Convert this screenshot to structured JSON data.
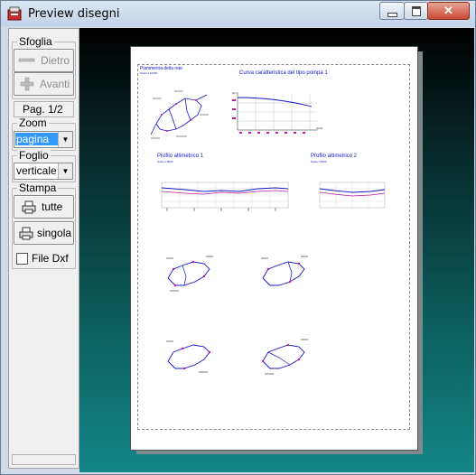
{
  "window": {
    "title": "Preview disegni",
    "controls": {
      "minimize": "minimize",
      "maximize": "maximize",
      "close": "close"
    }
  },
  "panel": {
    "sfoglia": {
      "label": "Sfoglia",
      "back": "Dietro",
      "forward": "Avanti"
    },
    "page_indicator": "Pag. 1/2",
    "zoom": {
      "label": "Zoom",
      "value": "pagina"
    },
    "foglio": {
      "label": "Foglio",
      "value": "verticale"
    },
    "stampa": {
      "label": "Stampa",
      "all": "tutte",
      "single": "singola"
    },
    "file_dxf": {
      "label": "File Dxf",
      "checked": false
    }
  },
  "drawing": {
    "planimetria_title": "Planimetria della rete",
    "planimetria_scale": "Scala 1:10000",
    "pump_curve_title": "Curva caratteristica del tipo pompa 1",
    "pump_axis_h": "H(m)",
    "pump_axis_q": "Q(l/s)",
    "profile1_title": "Profilo altimetrico 1",
    "profile1_scale": "Scala 1:5000",
    "profile2_title": "Profilo altimetrico 2",
    "profile2_scale": "Scala 1:5000"
  },
  "colors": {
    "titlebar": "#c3d3e8",
    "panel_bg": "#f0f0f0",
    "viewport_top": "#000000",
    "viewport_bottom": "#138686",
    "drawing_blue": "#1515c8",
    "drawing_magenta": "#c8149c",
    "selection": "#3399ff"
  }
}
